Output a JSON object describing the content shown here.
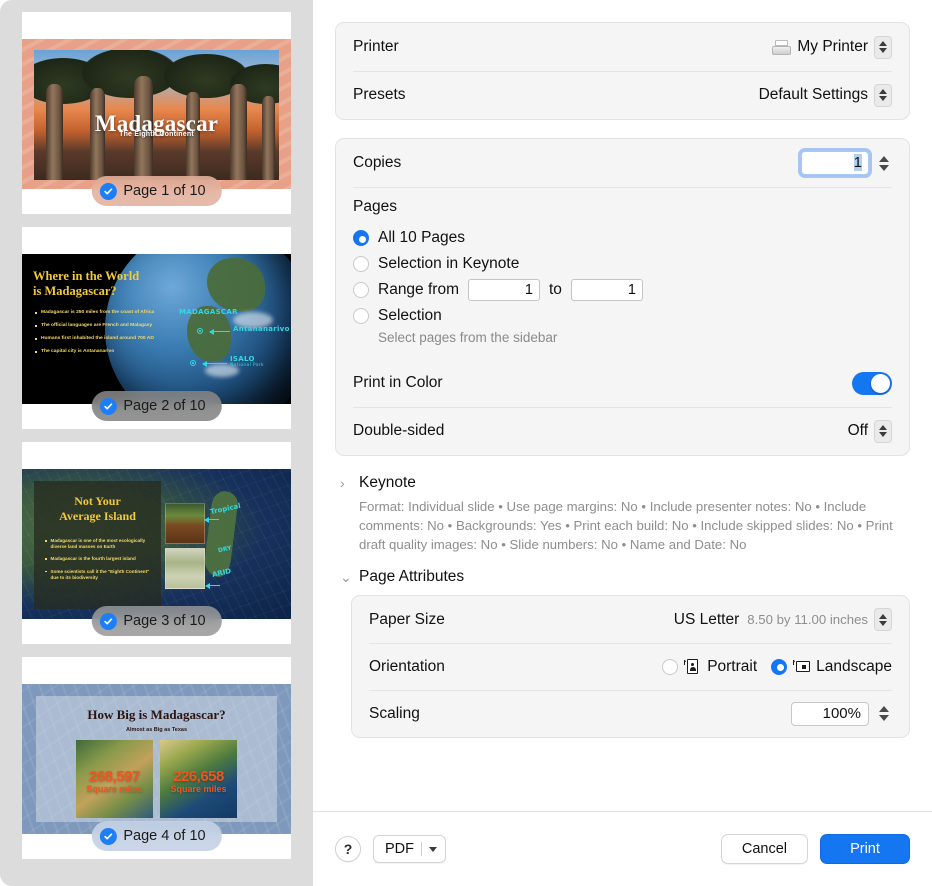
{
  "sidebar": {
    "thumbnails": [
      {
        "badge": "Page 1 of 10",
        "title": "Madagascar",
        "subtitle": "The Eighth Continent"
      },
      {
        "badge": "Page 2 of 10",
        "title_line1": "Where in the World",
        "title_line2": "is Madagascar?",
        "bullets": [
          "Madagascar is 250 miles from the coast of Africa",
          "The official languages are French and Malagasy",
          "Humans first inhabited the island around 700 AD",
          "The capital city is Antananarivo"
        ],
        "label_country": "MADAGASCAR",
        "label_capital": "Antananarivo",
        "label_park": "ISALO",
        "label_park_sub": "National Park"
      },
      {
        "badge": "Page 3 of 10",
        "title_line1": "Not Your",
        "title_line2": "Average Island",
        "bullets": [
          "Madagascar is one of the most ecologically diverse land masses on Earth",
          "Madagascar is the fourth largest island",
          "Some scientists call it the \"Eighth Continent\" due to its biodiversity"
        ],
        "label_tropical": "Tropical",
        "label_dry": "DRY",
        "label_arid": "ARID"
      },
      {
        "badge": "Page 4 of 10",
        "title": "How Big is Madagascar?",
        "subtitle": "Almost as Big as Texas",
        "stat_left_number": "268,597",
        "stat_left_unit": "Square miles",
        "stat_right_number": "226,658",
        "stat_right_unit": "Square miles"
      }
    ]
  },
  "print_dialog": {
    "printer": {
      "label": "Printer",
      "value": "My Printer"
    },
    "presets": {
      "label": "Presets",
      "value": "Default Settings"
    },
    "copies": {
      "label": "Copies",
      "value": "1"
    },
    "pages": {
      "label": "Pages",
      "options": [
        {
          "label": "All 10 Pages",
          "selected": true
        },
        {
          "label": "Selection in Keynote",
          "selected": false
        },
        {
          "label": "Range from",
          "selected": false
        },
        {
          "label": "Selection",
          "selected": false
        }
      ],
      "range_from_value": "1",
      "range_to_label": "to",
      "range_to_value": "1",
      "selection_hint": "Select pages from the sidebar"
    },
    "print_in_color": {
      "label": "Print in Color",
      "state": "on"
    },
    "double_sided": {
      "label": "Double-sided",
      "value": "Off"
    },
    "keynote_section": {
      "title": "Keynote",
      "expanded": false,
      "summary": "Format: Individual slide • Use page margins: No • Include presenter notes: No • Include comments: No • Backgrounds: Yes • Print each build: No • Include skipped slides: No • Print draft quality images: No • Slide numbers: No • Name and Date: No"
    },
    "page_attributes_section": {
      "title": "Page Attributes",
      "expanded": true,
      "paper_size": {
        "label": "Paper Size",
        "value": "US Letter",
        "dimensions": "8.50 by 11.00 inches"
      },
      "orientation": {
        "label": "Orientation",
        "options": [
          {
            "label": "Portrait",
            "selected": false
          },
          {
            "label": "Landscape",
            "selected": true
          }
        ]
      },
      "scaling": {
        "label": "Scaling",
        "value": "100%"
      }
    },
    "footer": {
      "help_label": "?",
      "pdf_label": "PDF",
      "cancel_label": "Cancel",
      "print_label": "Print"
    }
  },
  "colors": {
    "accent": "#1576f2",
    "sidebar_bg": "#dcdcdc",
    "group_bg": "#f5f5f5"
  }
}
